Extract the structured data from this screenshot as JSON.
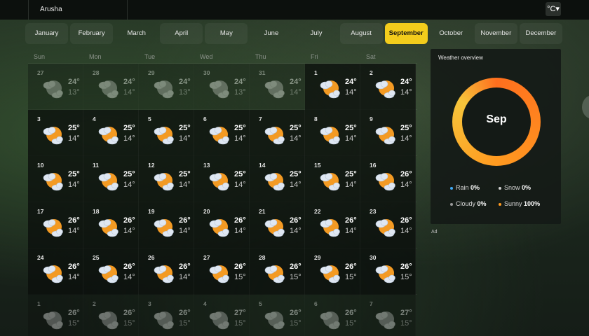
{
  "top_bar": {
    "city": "Arusha",
    "unit": "°C▾"
  },
  "months": [
    {
      "label": "January",
      "state": "faint"
    },
    {
      "label": "February",
      "state": "faint"
    },
    {
      "label": "March",
      "state": ""
    },
    {
      "label": "April",
      "state": "faint"
    },
    {
      "label": "May",
      "state": "faint"
    },
    {
      "label": "June",
      "state": ""
    },
    {
      "label": "July",
      "state": ""
    },
    {
      "label": "August",
      "state": "faint"
    },
    {
      "label": "September",
      "state": "active"
    },
    {
      "label": "October",
      "state": ""
    },
    {
      "label": "November",
      "state": "faint"
    },
    {
      "label": "December",
      "state": "faint"
    }
  ],
  "weekdays": [
    "Sun",
    "Mon",
    "Tue",
    "Wed",
    "Thu",
    "Fri",
    "Sat"
  ],
  "weeks": [
    [
      {
        "num": "27",
        "hi": "24°",
        "lo": "13°",
        "icon": "partly-cloudy-icon",
        "other": true
      },
      {
        "num": "28",
        "hi": "24°",
        "lo": "14°",
        "icon": "partly-cloudy-icon",
        "other": true
      },
      {
        "num": "29",
        "hi": "24°",
        "lo": "13°",
        "icon": "partly-cloudy-icon",
        "other": true
      },
      {
        "num": "30",
        "hi": "24°",
        "lo": "13°",
        "icon": "partly-cloudy-icon",
        "other": true
      },
      {
        "num": "31",
        "hi": "24°",
        "lo": "14°",
        "icon": "partly-cloudy-icon",
        "other": true
      },
      {
        "num": "1",
        "hi": "24°",
        "lo": "14°",
        "icon": "partly-cloudy-icon",
        "other": false
      },
      {
        "num": "2",
        "hi": "24°",
        "lo": "14°",
        "icon": "partly-cloudy-icon",
        "other": false
      }
    ],
    [
      {
        "num": "3",
        "hi": "25°",
        "lo": "14°",
        "icon": "partly-cloudy-icon",
        "other": false
      },
      {
        "num": "4",
        "hi": "25°",
        "lo": "14°",
        "icon": "partly-cloudy-icon",
        "other": false
      },
      {
        "num": "5",
        "hi": "25°",
        "lo": "14°",
        "icon": "partly-cloudy-icon",
        "other": false
      },
      {
        "num": "6",
        "hi": "25°",
        "lo": "14°",
        "icon": "partly-cloudy-icon",
        "other": false
      },
      {
        "num": "7",
        "hi": "25°",
        "lo": "14°",
        "icon": "partly-cloudy-icon",
        "other": false
      },
      {
        "num": "8",
        "hi": "25°",
        "lo": "14°",
        "icon": "partly-cloudy-icon",
        "other": false
      },
      {
        "num": "9",
        "hi": "25°",
        "lo": "14°",
        "icon": "partly-cloudy-icon",
        "other": false
      }
    ],
    [
      {
        "num": "10",
        "hi": "25°",
        "lo": "14°",
        "icon": "partly-cloudy-icon",
        "other": false
      },
      {
        "num": "11",
        "hi": "25°",
        "lo": "14°",
        "icon": "partly-cloudy-icon",
        "other": false
      },
      {
        "num": "12",
        "hi": "25°",
        "lo": "14°",
        "icon": "partly-cloudy-icon",
        "other": false
      },
      {
        "num": "13",
        "hi": "25°",
        "lo": "14°",
        "icon": "partly-cloudy-icon",
        "other": false
      },
      {
        "num": "14",
        "hi": "25°",
        "lo": "14°",
        "icon": "partly-cloudy-icon",
        "other": false
      },
      {
        "num": "15",
        "hi": "25°",
        "lo": "14°",
        "icon": "partly-cloudy-icon",
        "other": false
      },
      {
        "num": "16",
        "hi": "26°",
        "lo": "14°",
        "icon": "partly-cloudy-icon",
        "other": false
      }
    ],
    [
      {
        "num": "17",
        "hi": "26°",
        "lo": "14°",
        "icon": "partly-cloudy-icon",
        "other": false
      },
      {
        "num": "18",
        "hi": "26°",
        "lo": "14°",
        "icon": "partly-cloudy-icon",
        "other": false
      },
      {
        "num": "19",
        "hi": "26°",
        "lo": "14°",
        "icon": "partly-cloudy-icon",
        "other": false
      },
      {
        "num": "20",
        "hi": "26°",
        "lo": "14°",
        "icon": "partly-cloudy-icon",
        "other": false
      },
      {
        "num": "21",
        "hi": "26°",
        "lo": "14°",
        "icon": "partly-cloudy-icon",
        "other": false
      },
      {
        "num": "22",
        "hi": "26°",
        "lo": "14°",
        "icon": "partly-cloudy-icon",
        "other": false
      },
      {
        "num": "23",
        "hi": "26°",
        "lo": "14°",
        "icon": "partly-cloudy-icon",
        "other": false
      }
    ],
    [
      {
        "num": "24",
        "hi": "26°",
        "lo": "14°",
        "icon": "partly-cloudy-icon",
        "other": false
      },
      {
        "num": "25",
        "hi": "26°",
        "lo": "14°",
        "icon": "partly-cloudy-icon",
        "other": false
      },
      {
        "num": "26",
        "hi": "26°",
        "lo": "14°",
        "icon": "partly-cloudy-icon",
        "other": false
      },
      {
        "num": "27",
        "hi": "26°",
        "lo": "15°",
        "icon": "partly-cloudy-icon",
        "other": false
      },
      {
        "num": "28",
        "hi": "26°",
        "lo": "15°",
        "icon": "partly-cloudy-icon",
        "other": false
      },
      {
        "num": "29",
        "hi": "26°",
        "lo": "15°",
        "icon": "partly-cloudy-icon",
        "other": false
      },
      {
        "num": "30",
        "hi": "26°",
        "lo": "15°",
        "icon": "partly-cloudy-icon",
        "other": false
      }
    ],
    [
      {
        "num": "1",
        "hi": "26°",
        "lo": "15°",
        "icon": "partly-cloudy-icon",
        "other": true
      },
      {
        "num": "2",
        "hi": "26°",
        "lo": "15°",
        "icon": "partly-cloudy-icon",
        "other": true
      },
      {
        "num": "3",
        "hi": "26°",
        "lo": "15°",
        "icon": "partly-cloudy-icon",
        "other": true
      },
      {
        "num": "4",
        "hi": "27°",
        "lo": "15°",
        "icon": "partly-cloudy-icon",
        "other": true
      },
      {
        "num": "5",
        "hi": "26°",
        "lo": "15°",
        "icon": "partly-cloudy-icon",
        "other": true
      },
      {
        "num": "6",
        "hi": "26°",
        "lo": "15°",
        "icon": "partly-cloudy-icon",
        "other": true
      },
      {
        "num": "7",
        "hi": "27°",
        "lo": "15°",
        "icon": "partly-cloudy-icon",
        "other": true
      }
    ]
  ],
  "overview": {
    "title": "Weather overview",
    "donut_label": "Sep",
    "legend": [
      {
        "label": "Rain",
        "value": "0%",
        "color": "#3fa9f5"
      },
      {
        "label": "Snow",
        "value": "0%",
        "color": "#d0d0d0"
      },
      {
        "label": "Cloudy",
        "value": "0%",
        "color": "#9a9a9a"
      },
      {
        "label": "Sunny",
        "value": "100%",
        "color": "#ff9a20"
      }
    ],
    "sunny_fraction": 1.0
  },
  "ad_label": "Ad",
  "colors": {
    "accent": "#f3cc1c",
    "sunny": "#ff9a20"
  }
}
